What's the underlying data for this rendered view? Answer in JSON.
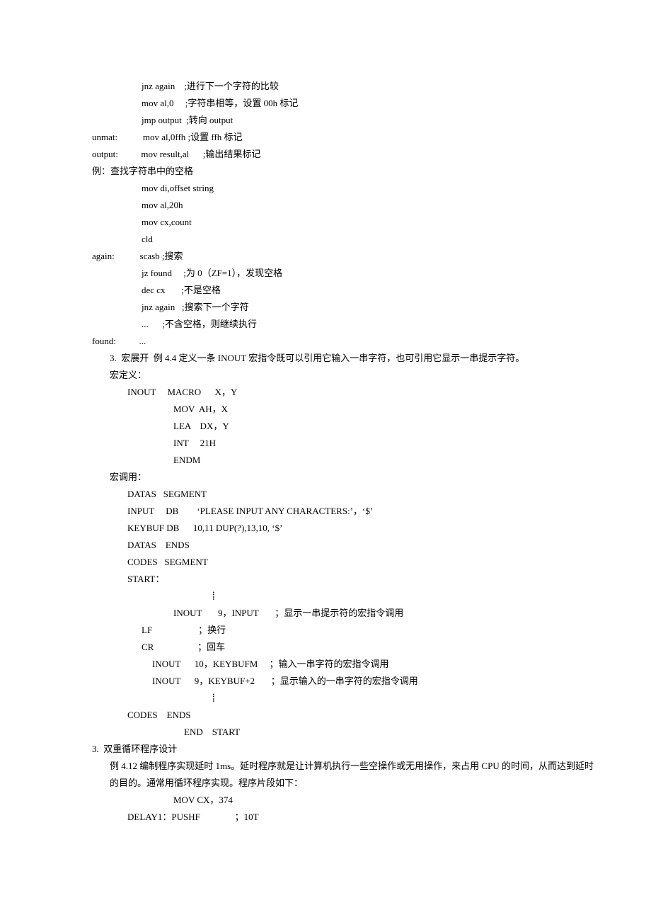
{
  "lines": [
    {
      "indent": 200,
      "text": "jnz again    ;进行下一个字符的比较"
    },
    {
      "indent": 200,
      "text": "mov al,0     ;字符串相等，设置 00h 标记"
    },
    {
      "indent": 200,
      "text": "jmp output  ;转向 output"
    },
    {
      "indent": 130,
      "text": "unmat:           mov al,0ffh ;设置 ffh 标记"
    },
    {
      "indent": 130,
      "text": "output:          mov result,al      ;输出结果标记"
    },
    {
      "indent": 130,
      "text": "例：查找字符串中的空格"
    },
    {
      "indent": 200,
      "text": "mov di,offset string"
    },
    {
      "indent": 200,
      "text": "mov al,20h"
    },
    {
      "indent": 200,
      "text": "mov cx,count"
    },
    {
      "indent": 200,
      "text": "cld"
    },
    {
      "indent": 130,
      "text": "again:           scasb ;搜索"
    },
    {
      "indent": 200,
      "text": "jz found     ;为 0（ZF=1），发现空格"
    },
    {
      "indent": 200,
      "text": "dec cx       ;不是空格"
    },
    {
      "indent": 200,
      "text": "jnz again   ;搜索下一个字符"
    },
    {
      "indent": 200,
      "text": "...      ;不含空格，则继续执行"
    },
    {
      "indent": 130,
      "text": "found:          ..."
    },
    {
      "indent": 155,
      "text": "3.  宏展开  例 4.4 定义一条 INOUT 宏指令既可以引用它输入一串字符，也可引用它显示一串提示字符。"
    },
    {
      "indent": 155,
      "text": "宏定义："
    },
    {
      "indent": 180,
      "text": "INOUT     MACRO      X，Y"
    },
    {
      "indent": 245,
      "text": "MOV  AH，X"
    },
    {
      "indent": 245,
      "text": "LEA    DX，Y"
    },
    {
      "indent": 245,
      "text": "INT     21H"
    },
    {
      "indent": 245,
      "text": "ENDM"
    },
    {
      "indent": 155,
      "text": "宏调用："
    },
    {
      "indent": 180,
      "text": "DATAS   SEGMENT"
    },
    {
      "indent": 180,
      "text": "INPUT     DB        ‘PLEASE INPUT ANY CHARACTERS:’，‘$’"
    },
    {
      "indent": 180,
      "text": "KEYBUF DB      10,11 DUP(?),13,10, ‘$’"
    },
    {
      "indent": 180,
      "text": "DATAS    ENDS"
    },
    {
      "indent": 180,
      "text": "CODES   SEGMENT"
    },
    {
      "indent": 180,
      "text": "START："
    },
    {
      "indent": 300,
      "text": "",
      "vdots": true
    },
    {
      "indent": 245,
      "text": "INOUT       9，INPUT       ；显示一串提示符的宏指令调用"
    },
    {
      "indent": 200,
      "text": "LF                    ；换行"
    },
    {
      "indent": 200,
      "text": "CR                   ；回车"
    },
    {
      "indent": 215,
      "text": "INOUT      10，KEYBUFM     ；输入一串字符的宏指令调用"
    },
    {
      "indent": 215,
      "text": "INOUT      9，KEYBUF+2       ；显示输入的一串字符的宏指令调用"
    },
    {
      "indent": 300,
      "text": "",
      "vdots": true
    },
    {
      "indent": 180,
      "text": "CODES    ENDS"
    },
    {
      "indent": 260,
      "text": "END    START"
    },
    {
      "indent": 130,
      "text": "3.  双重循环程序设计"
    },
    {
      "indent": 155,
      "text": "例 4.12 编制程序实现延时 1ms。延时程序就是让计算机执行一些空操作或无用操作，来占用 CPU 的时间，从而达到延时"
    },
    {
      "indent": 155,
      "text": "的目的。通常用循环程序实现。程序片段如下："
    },
    {
      "indent": 245,
      "text": "MOV CX，374"
    },
    {
      "indent": 180,
      "text": "DELAY1：PUSHF               ；10T"
    }
  ]
}
